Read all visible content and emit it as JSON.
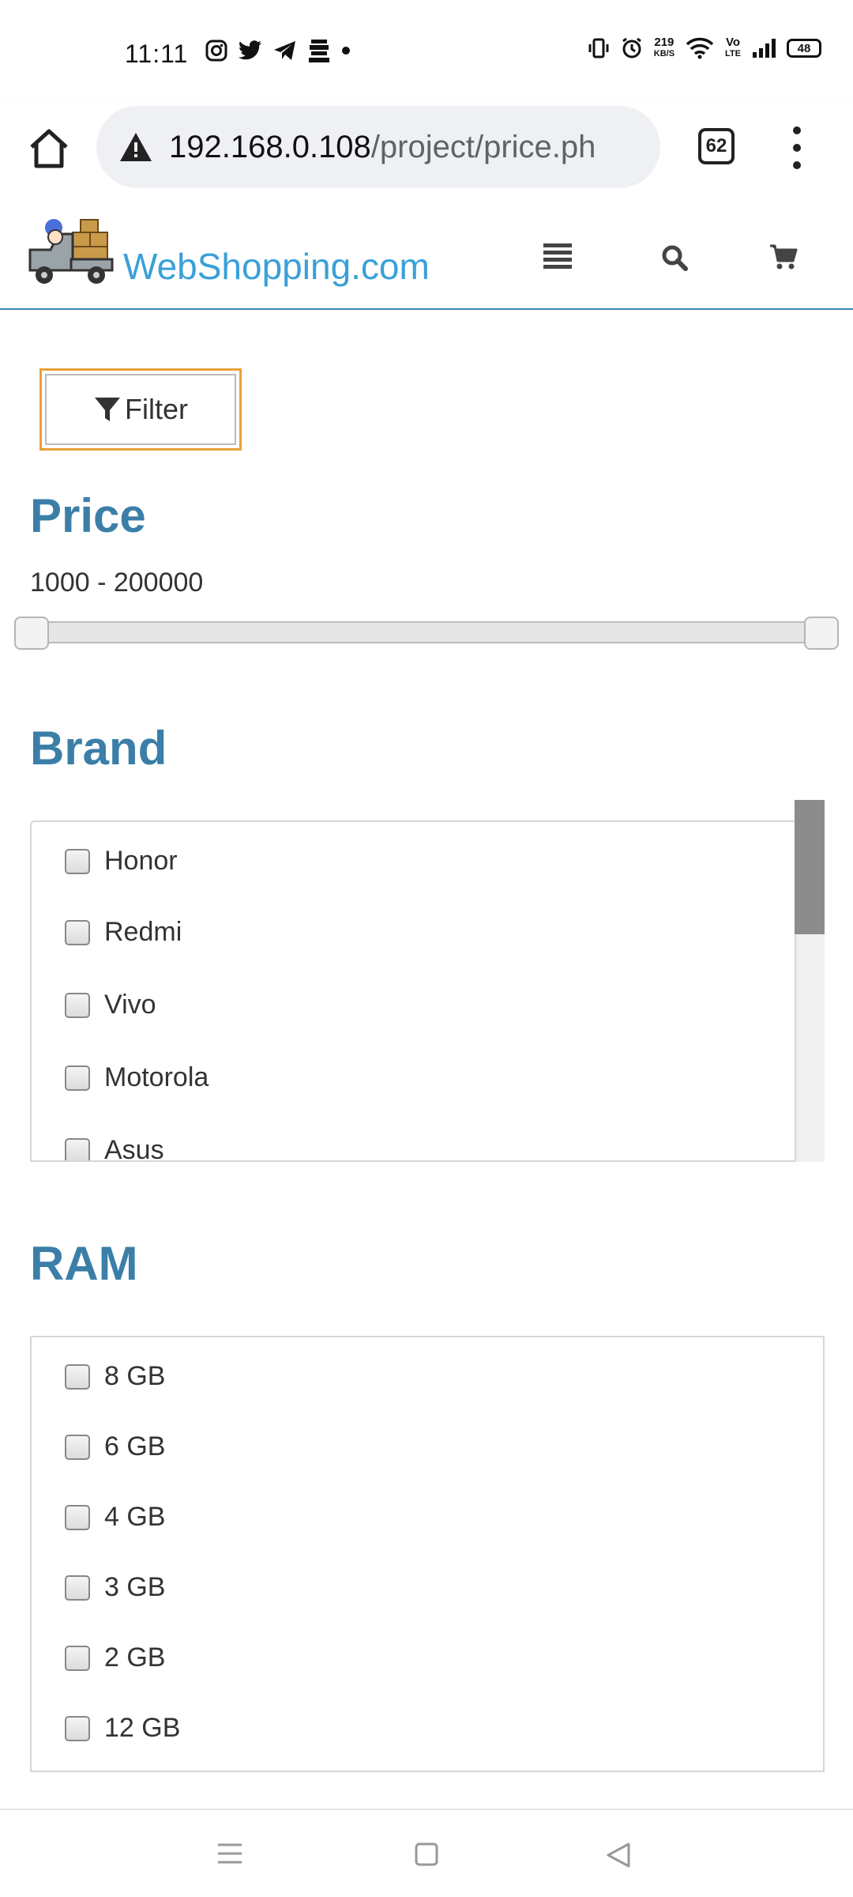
{
  "status_bar": {
    "time": "11:11",
    "left_icons": [
      "instagram-icon",
      "twitter-icon",
      "telegram-icon",
      "app-icon",
      "dot-icon"
    ],
    "speed_value": "219",
    "speed_unit": "KB/S",
    "volte_top": "Vo",
    "volte_bottom": "LTE",
    "battery": "48"
  },
  "browser": {
    "url_host": "192.168.0.108",
    "url_path": "/project/price.ph",
    "tab_count": "62"
  },
  "site": {
    "logo_text": "WebShopping.com",
    "accent": "#3aa0d8",
    "title_color": "#3b7fa8"
  },
  "filter": {
    "button_label": "Filter"
  },
  "price": {
    "title": "Price",
    "range": "1000 - 200000",
    "min": 1000,
    "max": 200000,
    "selected_low_fraction": 0.0,
    "selected_high_fraction": 1.0
  },
  "brand": {
    "title": "Brand",
    "items": [
      {
        "label": "Honor",
        "checked": false
      },
      {
        "label": "Redmi",
        "checked": false
      },
      {
        "label": "Vivo",
        "checked": false
      },
      {
        "label": "Motorola",
        "checked": false
      },
      {
        "label": "Asus",
        "checked": false
      }
    ]
  },
  "ram": {
    "title": "RAM",
    "items": [
      {
        "label": "8 GB",
        "checked": false
      },
      {
        "label": "6 GB",
        "checked": false
      },
      {
        "label": "4 GB",
        "checked": false
      },
      {
        "label": "3 GB",
        "checked": false
      },
      {
        "label": "2 GB",
        "checked": false
      },
      {
        "label": "12 GB",
        "checked": false
      }
    ]
  }
}
